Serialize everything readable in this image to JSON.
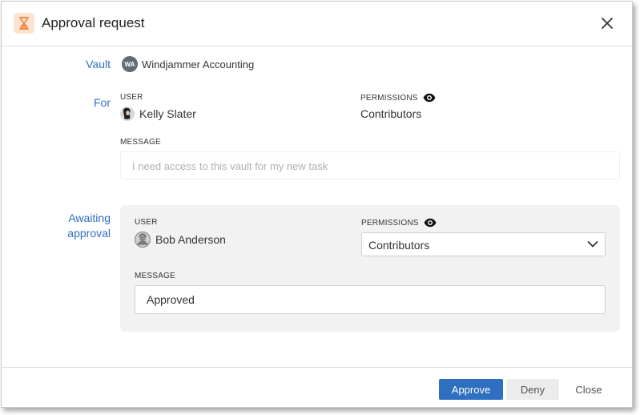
{
  "dialog": {
    "title": "Approval request",
    "icon": "hourglass-icon",
    "close_icon": "close-icon"
  },
  "vault": {
    "label": "Vault",
    "initials": "WA",
    "name": "Windjammer Accounting"
  },
  "for": {
    "label": "For",
    "user_heading": "USER",
    "user_name": "Kelly Slater",
    "permissions_heading": "PERMISSIONS",
    "permissions_value": "Contributors",
    "message_heading": "MESSAGE",
    "message_text": "I need access to this vault for my new task"
  },
  "awaiting": {
    "label_line1": "Awaiting",
    "label_line2": "approval",
    "user_heading": "USER",
    "user_name": "Bob Anderson",
    "permissions_heading": "PERMISSIONS",
    "permissions_selected": "Contributors",
    "message_heading": "MESSAGE",
    "message_value": "Approved"
  },
  "footer": {
    "approve_label": "Approve",
    "deny_label": "Deny",
    "close_label": "Close"
  },
  "colors": {
    "accent": "#2f6fbf",
    "icon_bg": "#fde3cf",
    "icon_fg": "#e8833a",
    "panel_bg": "#f2f2f2"
  }
}
